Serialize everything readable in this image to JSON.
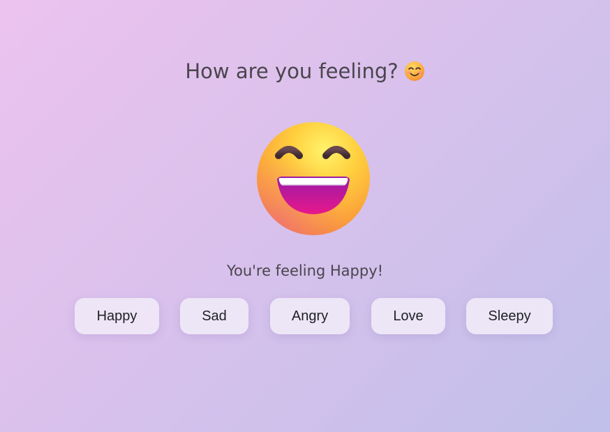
{
  "header": {
    "title": "How are you feeling?",
    "title_emoji_icon": "smiling-face-icon"
  },
  "display": {
    "current_emoji_icon": "grinning-face-with-smiling-eyes-icon",
    "status_text": "You're feeling Happy!"
  },
  "moods": {
    "buttons": [
      {
        "label": "Happy"
      },
      {
        "label": "Sad"
      },
      {
        "label": "Angry"
      },
      {
        "label": "Love"
      },
      {
        "label": "Sleepy"
      }
    ]
  },
  "colors": {
    "background_start": "#ecc3ee",
    "background_end": "#c0c0ea",
    "text": "#4a454d",
    "button_bg": "#f0eaf8"
  }
}
